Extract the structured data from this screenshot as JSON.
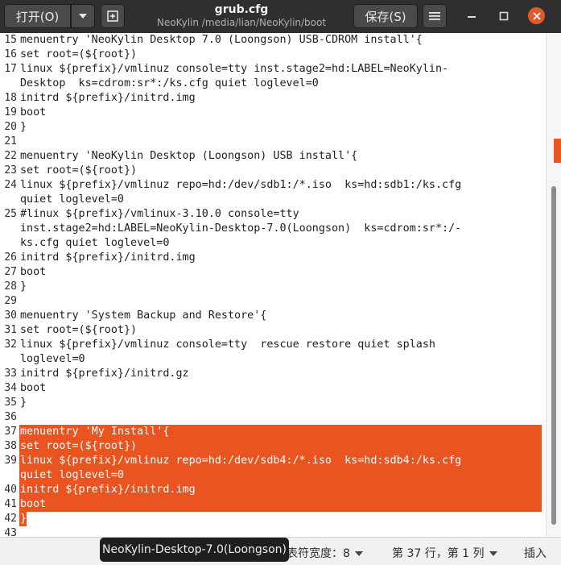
{
  "window": {
    "title": "grub.cfg",
    "path": "NeoKylin /media/lian/NeoKylin/boot",
    "open_label": "打开(O)",
    "save_label": "保存(S)"
  },
  "editor": {
    "lines": [
      {
        "num": "15",
        "text": "menuentry 'NeoKylin Desktop 7.0 (Loongson) USB-CDROM install'{"
      },
      {
        "num": "16",
        "text": "set root=(${root})"
      },
      {
        "num": "17",
        "text": "linux ${prefix}/vmlinuz console=tty inst.stage2=hd:LABEL=NeoKylin-"
      },
      {
        "num": "",
        "text": "Desktop  ks=cdrom:sr*:/ks.cfg quiet loglevel=0"
      },
      {
        "num": "18",
        "text": "initrd ${prefix}/initrd.img"
      },
      {
        "num": "19",
        "text": "boot"
      },
      {
        "num": "20",
        "text": "}"
      },
      {
        "num": "21",
        "text": ""
      },
      {
        "num": "22",
        "text": "menuentry 'NeoKylin Desktop (Loongson) USB install'{"
      },
      {
        "num": "23",
        "text": "set root=(${root})"
      },
      {
        "num": "24",
        "text": "linux ${prefix}/vmlinuz repo=hd:/dev/sdb1:/*.iso  ks=hd:sdb1:/ks.cfg"
      },
      {
        "num": "",
        "text": "quiet loglevel=0"
      },
      {
        "num": "25",
        "text": "#linux ${prefix}/vmlinux-3.10.0 console=tty"
      },
      {
        "num": "",
        "text": "inst.stage2=hd:LABEL=NeoKylin-Desktop-7.0(Loongson)  ks=cdrom:sr*:/-"
      },
      {
        "num": "",
        "text": "ks.cfg quiet loglevel=0"
      },
      {
        "num": "26",
        "text": "initrd ${prefix}/initrd.img"
      },
      {
        "num": "27",
        "text": "boot"
      },
      {
        "num": "28",
        "text": "}"
      },
      {
        "num": "29",
        "text": ""
      },
      {
        "num": "30",
        "text": "menuentry 'System Backup and Restore'{"
      },
      {
        "num": "31",
        "text": "set root=(${root})"
      },
      {
        "num": "32",
        "text": "linux ${prefix}/vmlinuz console=tty  rescue restore quiet splash"
      },
      {
        "num": "",
        "text": "loglevel=0"
      },
      {
        "num": "33",
        "text": "initrd ${prefix}/initrd.gz"
      },
      {
        "num": "34",
        "text": "boot"
      },
      {
        "num": "35",
        "text": "}"
      },
      {
        "num": "36",
        "text": ""
      },
      {
        "num": "37",
        "text": "menuentry 'My Install'{"
      },
      {
        "num": "38",
        "text": "set root=(${root})"
      },
      {
        "num": "39",
        "text": "linux ${prefix}/vmlinuz repo=hd:/dev/sdb4:/*.iso  ks=hd:sdb4:/ks.cfg"
      },
      {
        "num": "",
        "text": "quiet loglevel=0"
      },
      {
        "num": "40",
        "text": "initrd ${prefix}/initrd.img"
      },
      {
        "num": "41",
        "text": "boot"
      },
      {
        "num": "42",
        "text": "}"
      },
      {
        "num": "43",
        "text": ""
      }
    ],
    "selection_color": "#e95420"
  },
  "statusbar": {
    "tab_width": "表符宽度：8",
    "position": "第 37 行，第 1 列",
    "mode": "插入"
  },
  "tooltip": {
    "text": "NeoKylin-Desktop-7.0(Loongson)"
  }
}
